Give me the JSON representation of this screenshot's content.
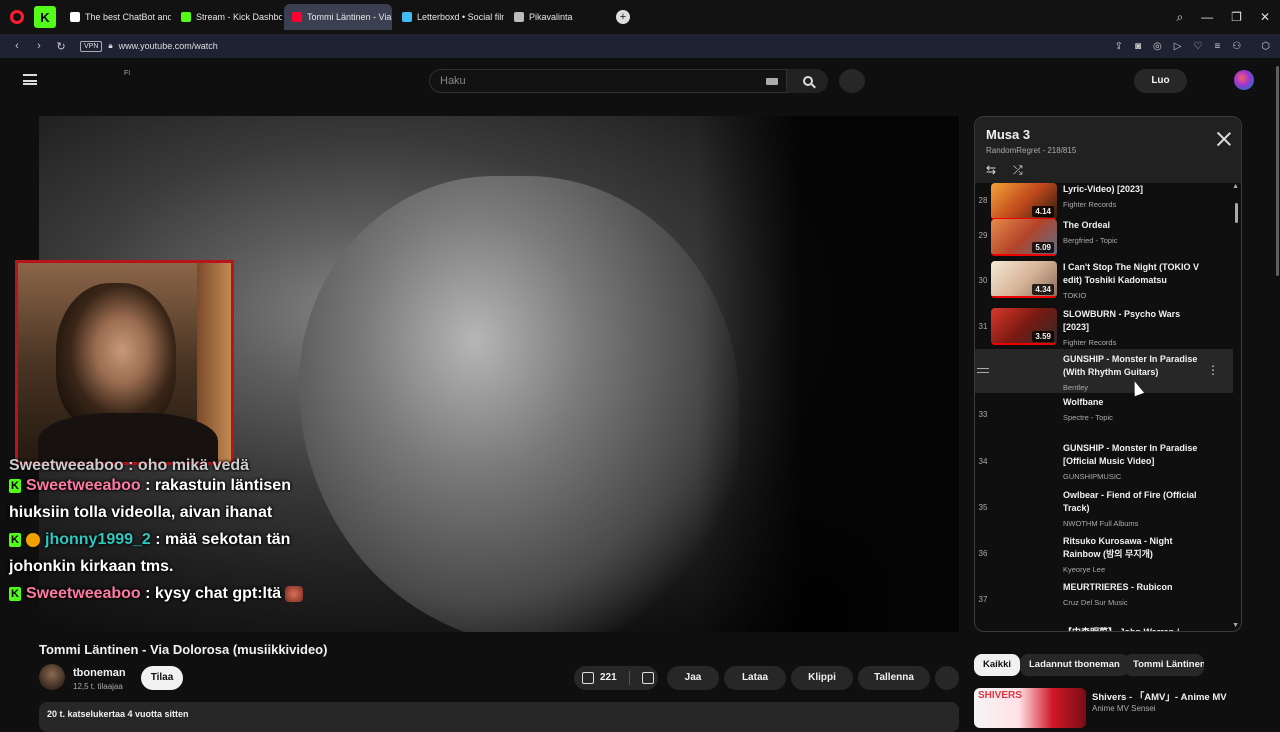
{
  "browser": {
    "tabs": [
      {
        "label": "The best ChatBot and Wid",
        "fav": "#ffffff",
        "active": false
      },
      {
        "label": "Stream - Kick Dashboard",
        "fav": "#53fc18",
        "active": false
      },
      {
        "label": "Tommi Läntinen - Via",
        "fav": "#ff0033",
        "active": true
      },
      {
        "label": "Letterboxd • Social film di",
        "fav": "#40bcf4",
        "active": false
      },
      {
        "label": "Pikavalinta",
        "fav": "#bbbbbb",
        "active": false
      }
    ],
    "url": "www.youtube.com/watch",
    "vpn": "VPN"
  },
  "header": {
    "region": "FI",
    "search_placeholder": "Haku",
    "create_label": "Luo"
  },
  "chat": {
    "cut_line": "Sweetweeaboo : oho mikä vedä",
    "messages": [
      {
        "user": "Sweetweeaboo",
        "text": ": rakastuin läntisen hiuksiin tolla videolla, aivan ihanat"
      },
      {
        "user": "jhonny1999_2",
        "text": ": mää sekotan tän johonkin kirkaan tms."
      },
      {
        "user": "Sweetweeaboo",
        "text": ": kysy chat gpt:ltä"
      }
    ]
  },
  "video": {
    "title": "Tommi Läntinen - Via Dolorosa (musiikkivideo)",
    "channel": "tboneman",
    "subs": "12,5 t. tilaajaa",
    "subscribe": "Tilaa",
    "likes": "221",
    "share": "Jaa",
    "download": "Lataa",
    "clip": "Klippi",
    "save": "Tallenna",
    "desc": "20 t. katselukertaa  4 vuotta sitten"
  },
  "playlist": {
    "title": "Musa 3",
    "subtitle": "RandomRegret - 218/815",
    "items": [
      {
        "num": "28",
        "title": "Lyric-Video) [2023]",
        "channel": "Fighter Records",
        "duration": "4.14",
        "has_thumb": true,
        "thumb": "linear-gradient(135deg,#f2a23a,#c24a1c,#2a1a10)"
      },
      {
        "num": "29",
        "title": "The Ordeal",
        "channel": "Bergfried - Topic",
        "duration": "5.09",
        "has_thumb": true,
        "thumb": "linear-gradient(135deg,#e88a4a,#b2442a,#5c6e8a)"
      },
      {
        "num": "30",
        "title": "I Can't Stop The Night (TOKIO V edit) Toshiki Kadomatsu",
        "channel": "TOKIO",
        "duration": "4.34",
        "has_thumb": true,
        "thumb": "linear-gradient(135deg,#f5e8d5,#d8b69a,#8a6a58)"
      },
      {
        "num": "31",
        "title": "SLOWBURN - Psycho Wars [2023]",
        "channel": "Fighter Records",
        "duration": "3.59",
        "has_thumb": true,
        "thumb": "linear-gradient(135deg,#d8382a,#7a1a12,#2a2a2a)"
      },
      {
        "num": "",
        "title": "GUNSHIP - Monster In Paradise (With Rhythm Guitars)",
        "channel": "Bentley",
        "duration": "",
        "has_thumb": false,
        "thumb": ""
      },
      {
        "num": "33",
        "title": "Wolfbane",
        "channel": "Spectre - Topic",
        "duration": "",
        "has_thumb": false,
        "thumb": ""
      },
      {
        "num": "34",
        "title": "GUNSHIP - Monster In Paradise [Official Music Video]",
        "channel": "GUNSHIPMUSIC",
        "duration": "",
        "has_thumb": false,
        "thumb": ""
      },
      {
        "num": "35",
        "title": "Owlbear - Fiend of Fire (Official Track)",
        "channel": "NWOTHM Full Albums",
        "duration": "",
        "has_thumb": false,
        "thumb": ""
      },
      {
        "num": "36",
        "title": "Ritsuko Kurosawa - Night Rainbow (밤의 무지개)",
        "channel": "Kyeorye Lee",
        "duration": "",
        "has_thumb": false,
        "thumb": ""
      },
      {
        "num": "37",
        "title": "MEURTRIERES - Rubicon",
        "channel": "Cruz Del Sur Music",
        "duration": "",
        "has_thumb": false,
        "thumb": ""
      },
      {
        "num": "",
        "title": "【中森明菜】 John Warren /",
        "channel": "",
        "duration": "",
        "has_thumb": false,
        "thumb": ""
      }
    ]
  },
  "chips": [
    "Kaikki",
    "Ladannut tboneman",
    "Tommi Läntinen"
  ],
  "recommended": {
    "thumb_text": "SHIVERS",
    "title": "Shivers - 「AMV」- Anime MV",
    "channel": "Anime MV Sensei"
  }
}
